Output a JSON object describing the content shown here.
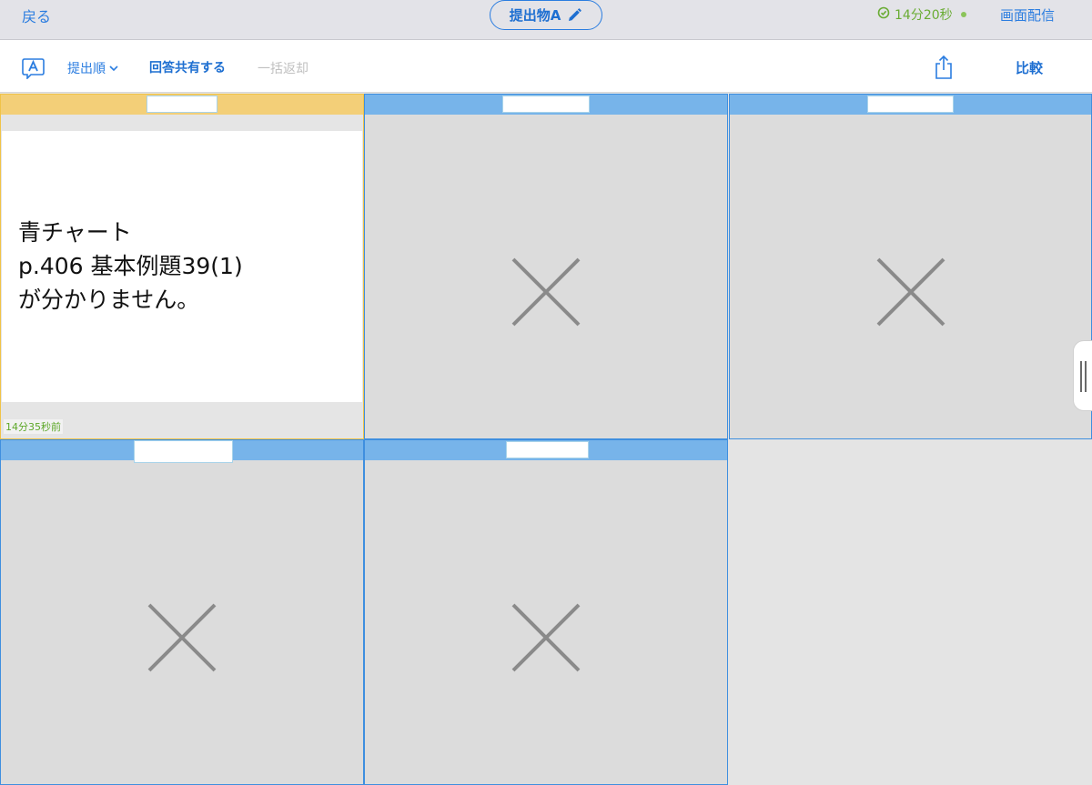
{
  "topbar": {
    "back_label": "戻る",
    "title": "提出物A",
    "timer": "14分20秒",
    "broadcast_label": "画面配信"
  },
  "toolbar": {
    "sort_label": "提出順",
    "share_answers_label": "回答共有する",
    "return_all_label": "一括返却",
    "compare_label": "比較"
  },
  "cards": [
    {
      "status": "submitted",
      "header_color": "#f3cf78",
      "content_lines": [
        "青チャート",
        "p.406 基本例題39(1)",
        "が分かりません。"
      ],
      "time_ago": "14分35秒前"
    },
    {
      "status": "not-submitted",
      "header_color": "#77b4ea"
    },
    {
      "status": "not-submitted",
      "header_color": "#77b4ea"
    },
    {
      "status": "not-submitted",
      "header_color": "#77b4ea"
    },
    {
      "status": "not-submitted",
      "header_color": "#77b4ea"
    }
  ],
  "colors": {
    "accent": "#2b7de0",
    "timer_green": "#6aac34",
    "blue_header": "#77b4ea",
    "yellow_header": "#f3cf78"
  }
}
